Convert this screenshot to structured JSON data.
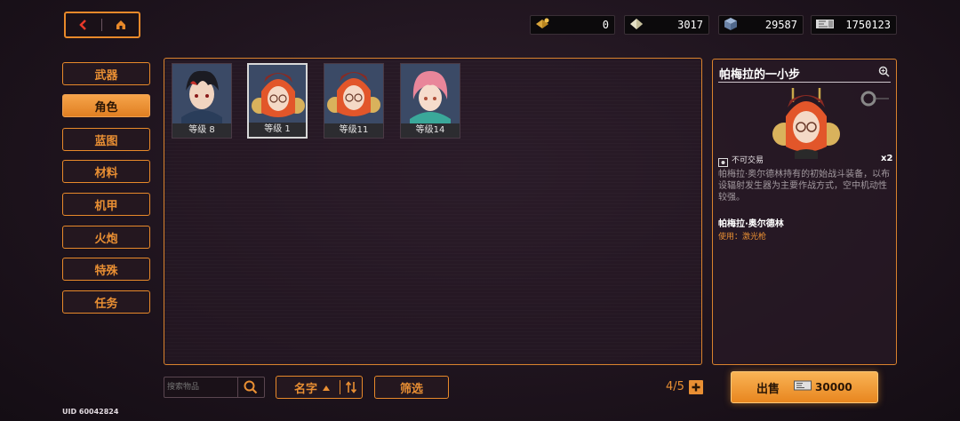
{
  "currencies": [
    {
      "icon": "gold-crystal-icon",
      "value": "0"
    },
    {
      "icon": "diamond-icon",
      "value": "3017"
    },
    {
      "icon": "cube-icon",
      "value": "29587"
    },
    {
      "icon": "ticket-icon",
      "value": "1750123"
    }
  ],
  "categories": [
    {
      "label": "武器",
      "active": false
    },
    {
      "label": "角色",
      "active": true
    },
    {
      "label": "蓝图",
      "active": false
    },
    {
      "label": "材料",
      "active": false
    },
    {
      "label": "机甲",
      "active": false
    },
    {
      "label": "火炮",
      "active": false
    },
    {
      "label": "特殊",
      "active": false
    },
    {
      "label": "任务",
      "active": false
    }
  ],
  "items": [
    {
      "level": "等级 8"
    },
    {
      "level": "等级 1"
    },
    {
      "level": "等级11"
    },
    {
      "level": "等级14"
    }
  ],
  "detail": {
    "title": "帕梅拉的一小步",
    "tradable": "不可交易",
    "count": "x2",
    "description": "帕梅拉·奥尔德林持有的初始战斗装备，以布设辐射发生器为主要作战方式，空中机动性较强。",
    "owner": "帕梅拉·奥尔德林",
    "usage": "使用：激光枪"
  },
  "bottom": {
    "search_placeholder": "搜索物品",
    "sort_label": "名字",
    "filter_label": "筛选",
    "capacity": "4/5",
    "sell_label": "出售",
    "sell_price": "30000"
  },
  "uid": "UID 60042824",
  "colors": {
    "accent": "#e8892a",
    "sell": "#f2a040"
  }
}
